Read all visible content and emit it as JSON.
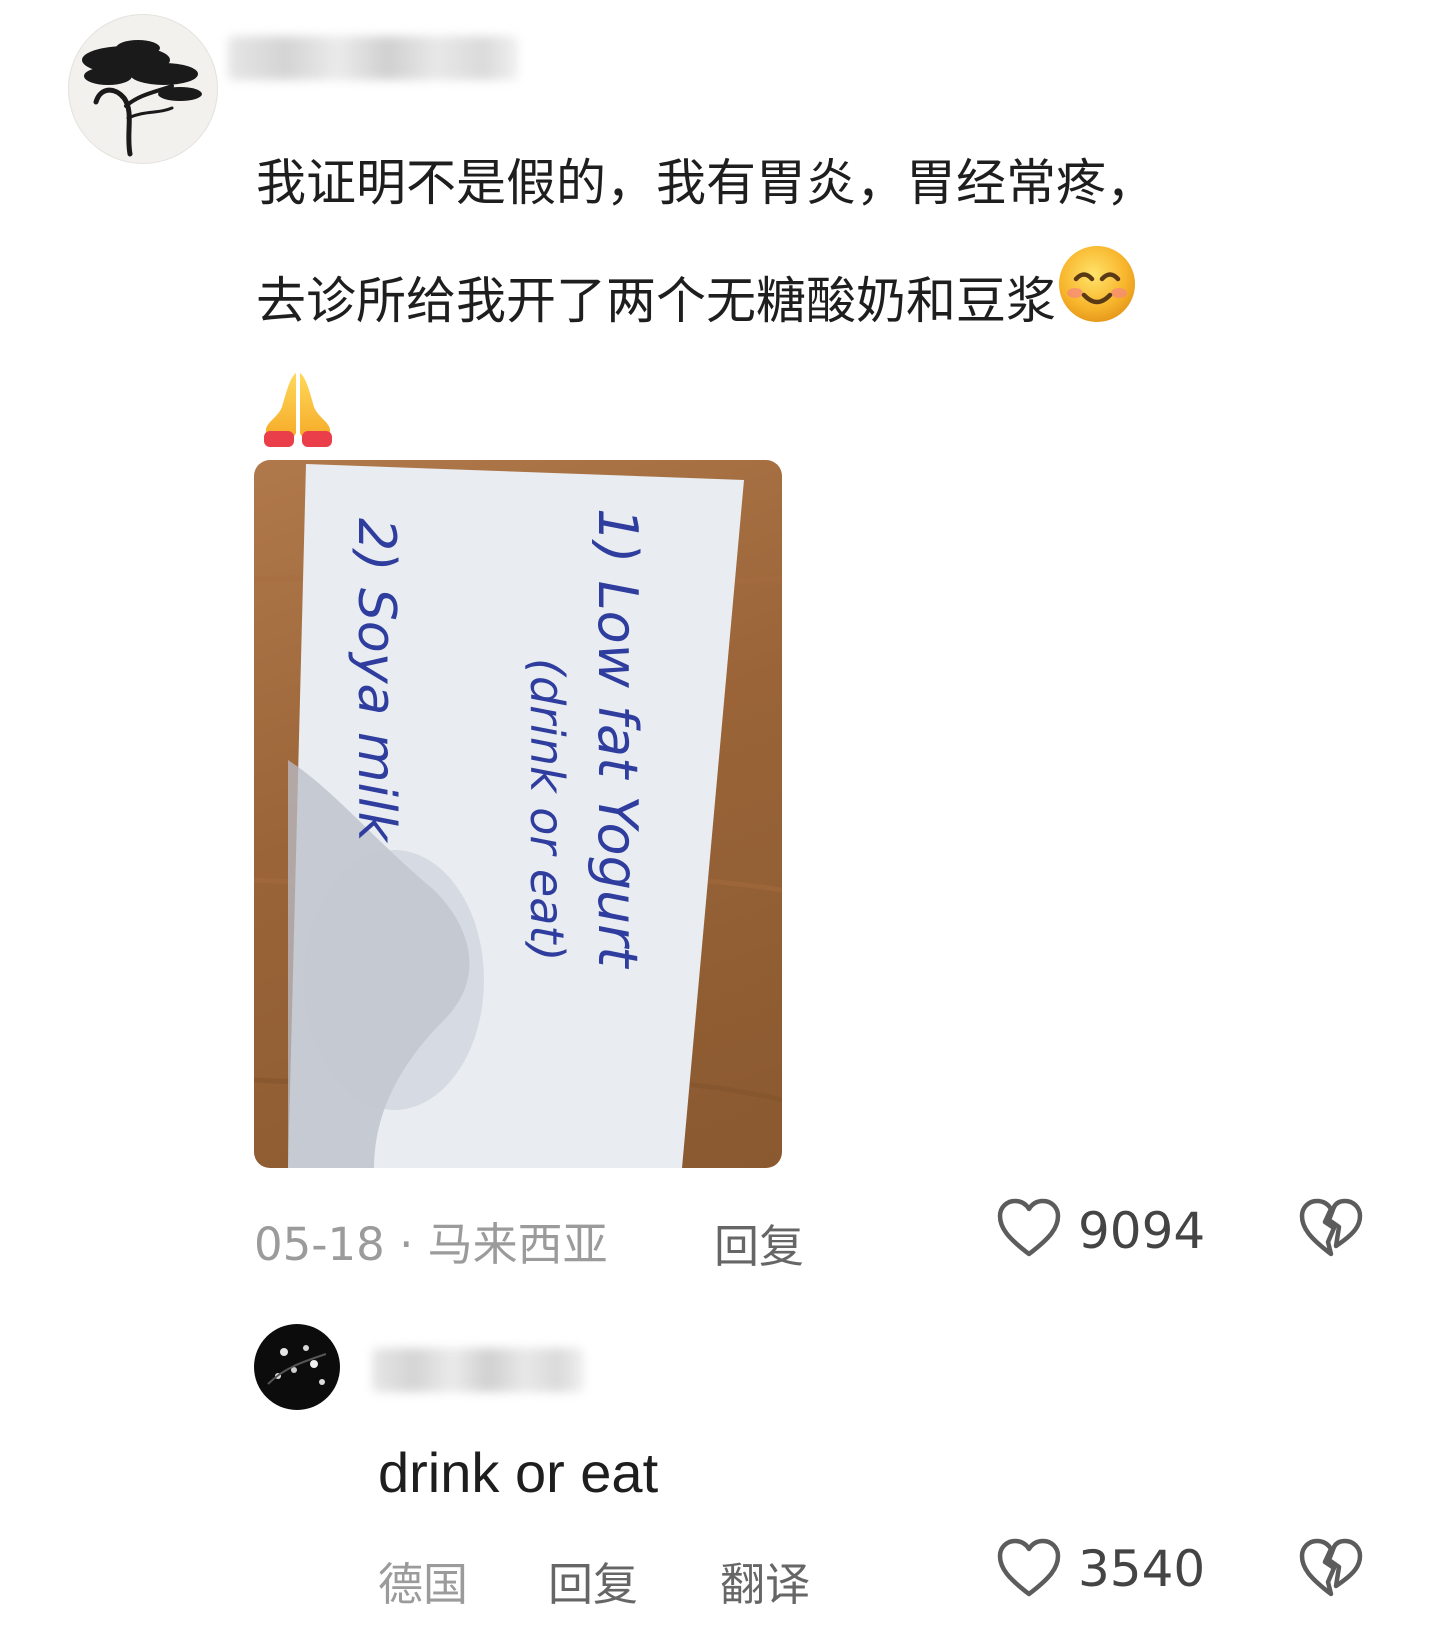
{
  "comments": [
    {
      "text_lines": [
        "我证明不是假的，我有胃炎，胃经常疼，",
        "去诊所给我开了两个无糖酸奶和豆浆"
      ],
      "emojis": [
        "smiling-face-emoji",
        "folded-hands-emoji"
      ],
      "photo": {
        "handwriting": [
          "1) Low fat Yogurt",
          "(drink or eat)",
          "2) Soya milk"
        ]
      },
      "date_location": "05-18 · 马来西亚",
      "reply_label": "回复",
      "likes": "9094"
    },
    {
      "text": "drink or eat",
      "location": "德国",
      "reply_label": "回复",
      "translate_label": "翻译",
      "likes": "3540"
    }
  ],
  "icons": {
    "like": "heart-outline-icon",
    "dislike": "broken-heart-icon"
  },
  "colors": {
    "meta_gray": "#9b9b9b",
    "text": "#1e1e1e",
    "handwriting_ink": "#2f3e9e"
  }
}
